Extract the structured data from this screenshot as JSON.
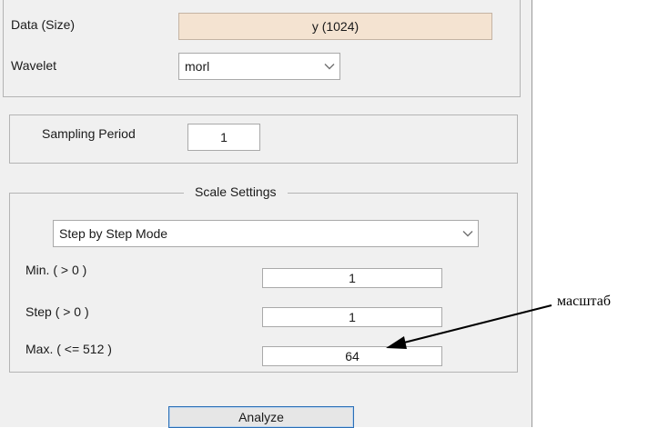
{
  "data_row": {
    "label": "Data  (Size)",
    "value": "y  (1024)"
  },
  "wavelet_row": {
    "label": "Wavelet",
    "value": "morl",
    "arrow_icon": "chevron-down-icon"
  },
  "sampling": {
    "label": "Sampling Period",
    "value": "1"
  },
  "scale_settings": {
    "title": "Scale Settings",
    "mode": "Step by Step Mode",
    "min": {
      "label": "Min. ( > 0 )",
      "value": "1"
    },
    "step": {
      "label": "Step ( > 0 )",
      "value": "1"
    },
    "max": {
      "label": "Max. ( <= 512 )",
      "value": "64"
    }
  },
  "analyze_label": "Analyze",
  "annotation": {
    "text": "масштаб",
    "color": "#000000"
  }
}
